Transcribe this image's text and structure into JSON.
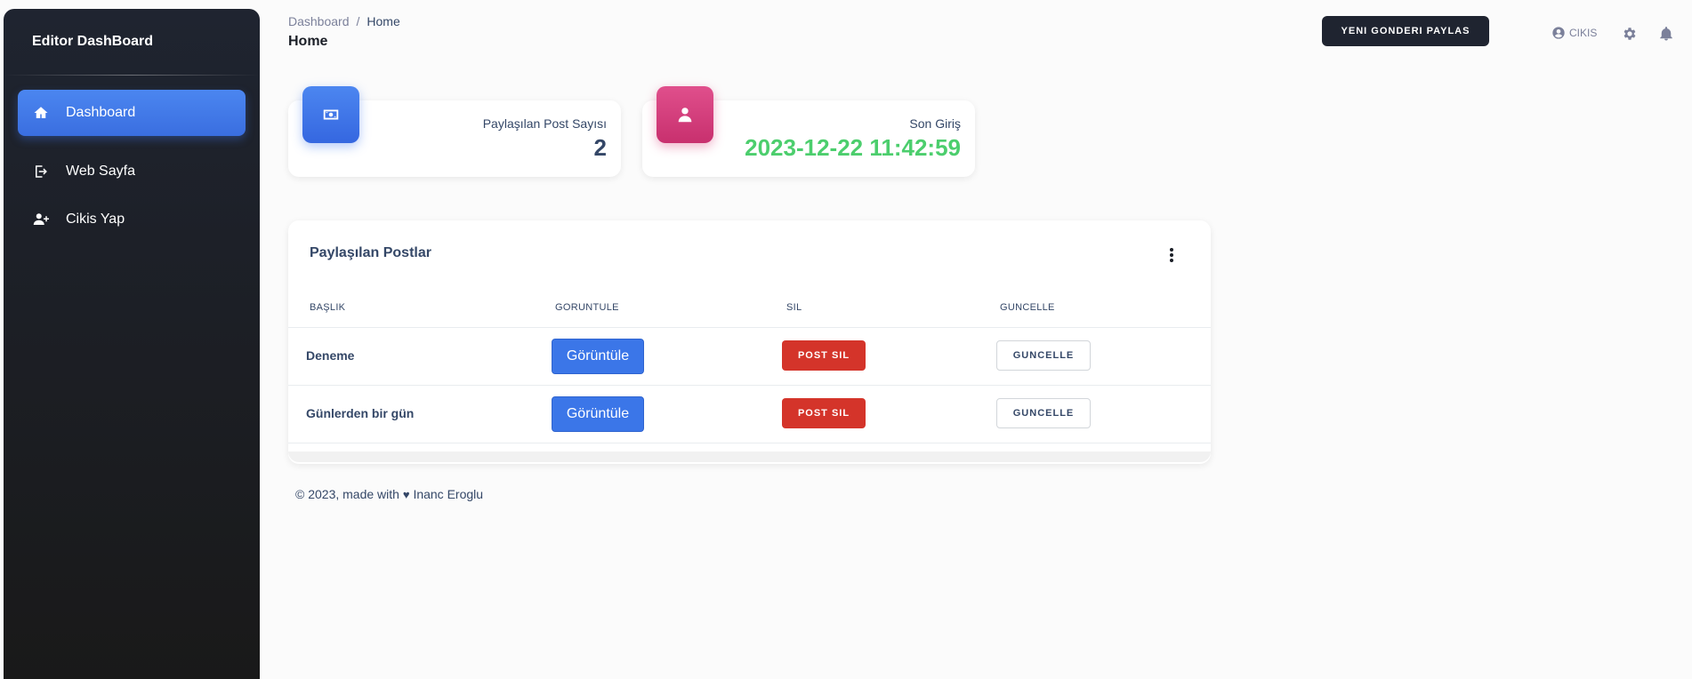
{
  "sidebar": {
    "brand": "Editor DashBoard",
    "items": [
      {
        "label": "Dashboard",
        "icon": "home-icon",
        "active": true
      },
      {
        "label": "Web Sayfa",
        "icon": "sign-out-icon",
        "active": false
      },
      {
        "label": "Cikis Yap",
        "icon": "user-plus-icon",
        "active": false
      }
    ]
  },
  "header": {
    "breadcrumb": {
      "root": "Dashboard",
      "separator": "/",
      "current": "Home"
    },
    "title": "Home",
    "new_post_button": "YENI GONDERI PAYLAS",
    "logout_label": "CIKIS"
  },
  "stats": [
    {
      "label": "Paylaşılan Post Sayısı",
      "value": "2",
      "icon": "money-icon",
      "color": "#3b6fe6"
    },
    {
      "label": "Son Giriş",
      "value": "2023-12-22 11:42:59",
      "icon": "user-icon",
      "color": "#d83b76"
    }
  ],
  "posts": {
    "title": "Paylaşılan Postlar",
    "columns": [
      "BAŞLIK",
      "GORUNTULE",
      "SIL",
      "GUNCELLE"
    ],
    "rows": [
      {
        "title": "Deneme",
        "view": "Görüntüle",
        "delete": "POST SIL",
        "update": "GUNCELLE"
      },
      {
        "title": "Günlerden bir gün",
        "view": "Görüntüle",
        "delete": "POST SIL",
        "update": "GUNCELLE"
      }
    ]
  },
  "footer": {
    "prefix": "© 2023, made with",
    "heart": "♥",
    "author": "Inanc Eroglu"
  },
  "colors": {
    "sidebar_bg": "#1f2430",
    "accent_blue": "#3b76e8",
    "danger_red": "#d4342a",
    "success_green": "#4cce6d",
    "pink": "#d83b76"
  }
}
